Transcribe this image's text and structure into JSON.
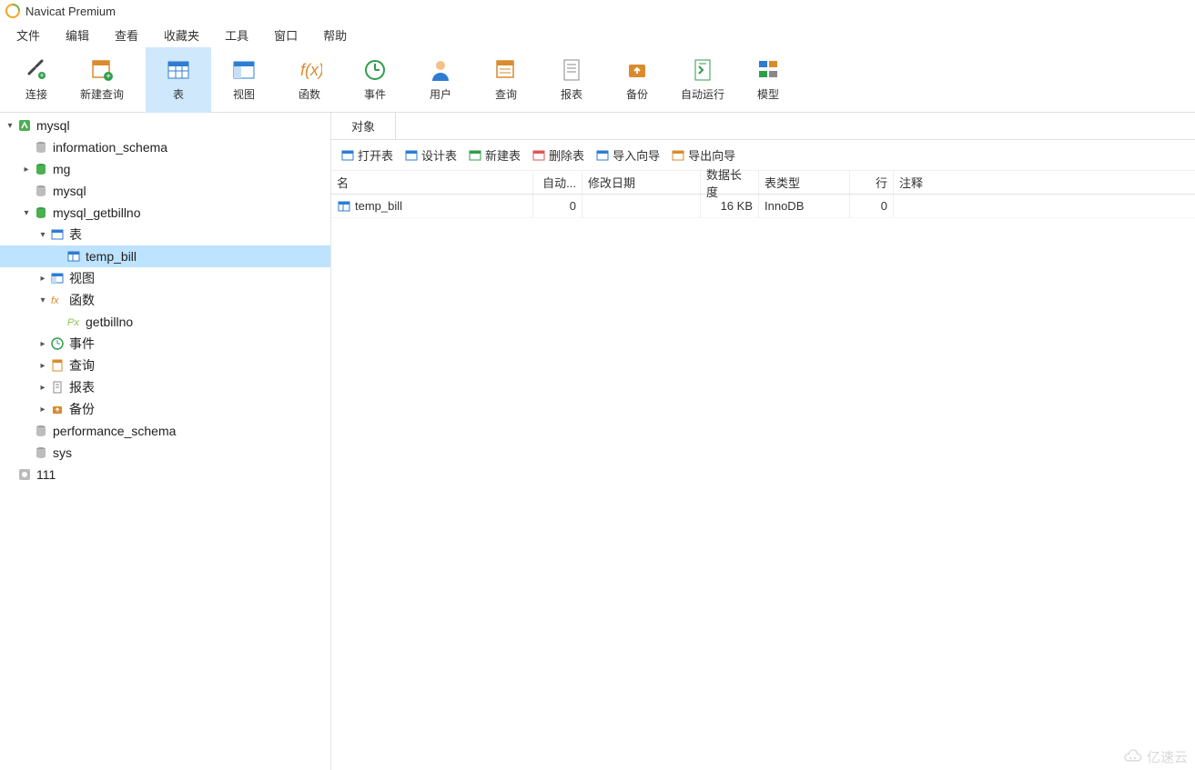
{
  "title": "Navicat Premium",
  "menubar": [
    "文件",
    "编辑",
    "查看",
    "收藏夹",
    "工具",
    "窗口",
    "帮助"
  ],
  "toolbar": [
    {
      "label": "连接",
      "icon": "plug",
      "active": false
    },
    {
      "label": "新建查询",
      "icon": "new-query",
      "active": false
    },
    {
      "label": "表",
      "icon": "table",
      "active": true
    },
    {
      "label": "视图",
      "icon": "view",
      "active": false
    },
    {
      "label": "函数",
      "icon": "function",
      "active": false
    },
    {
      "label": "事件",
      "icon": "event",
      "active": false
    },
    {
      "label": "用户",
      "icon": "user",
      "active": false
    },
    {
      "label": "查询",
      "icon": "query",
      "active": false
    },
    {
      "label": "报表",
      "icon": "report",
      "active": false
    },
    {
      "label": "备份",
      "icon": "backup",
      "active": false
    },
    {
      "label": "自动运行",
      "icon": "autorun",
      "active": false
    },
    {
      "label": "模型",
      "icon": "model",
      "active": false
    }
  ],
  "tree": {
    "root": [
      {
        "indent": 0,
        "chevron": "down",
        "icon": "conn-green",
        "label": "mysql"
      },
      {
        "indent": 1,
        "chevron": "",
        "icon": "db",
        "label": "information_schema"
      },
      {
        "indent": 1,
        "chevron": "right",
        "icon": "db-green",
        "label": "mg"
      },
      {
        "indent": 1,
        "chevron": "",
        "icon": "db",
        "label": "mysql"
      },
      {
        "indent": 1,
        "chevron": "down",
        "icon": "db-green",
        "label": "mysql_getbillno"
      },
      {
        "indent": 2,
        "chevron": "down",
        "icon": "tables",
        "label": "表"
      },
      {
        "indent": 3,
        "chevron": "",
        "icon": "table",
        "label": "temp_bill",
        "selected": true
      },
      {
        "indent": 2,
        "chevron": "right",
        "icon": "views",
        "label": "视图"
      },
      {
        "indent": 2,
        "chevron": "down",
        "icon": "fx",
        "label": "函数"
      },
      {
        "indent": 3,
        "chevron": "",
        "icon": "px",
        "label": "getbillno"
      },
      {
        "indent": 2,
        "chevron": "right",
        "icon": "event",
        "label": "事件"
      },
      {
        "indent": 2,
        "chevron": "right",
        "icon": "query-s",
        "label": "查询"
      },
      {
        "indent": 2,
        "chevron": "right",
        "icon": "report-s",
        "label": "报表"
      },
      {
        "indent": 2,
        "chevron": "right",
        "icon": "backup-s",
        "label": "备份"
      },
      {
        "indent": 1,
        "chevron": "",
        "icon": "db",
        "label": "performance_schema"
      },
      {
        "indent": 1,
        "chevron": "",
        "icon": "db",
        "label": "sys"
      },
      {
        "indent": 0,
        "chevron": "",
        "icon": "conn-grey",
        "label": "111"
      }
    ]
  },
  "tab_label": "对象",
  "obj_toolbar": [
    {
      "label": "打开表",
      "icon": "open-table"
    },
    {
      "label": "设计表",
      "icon": "design-table"
    },
    {
      "label": "新建表",
      "icon": "new-table"
    },
    {
      "label": "删除表",
      "icon": "delete-table"
    },
    {
      "label": "导入向导",
      "icon": "import-wiz"
    },
    {
      "label": "导出向导",
      "icon": "export-wiz"
    }
  ],
  "grid_headers": {
    "name": "名",
    "auto": "自动...",
    "mod": "修改日期",
    "size": "数据长度",
    "type": "表类型",
    "rows": "行",
    "comment": "注释"
  },
  "grid_rows": [
    {
      "name": "temp_bill",
      "auto": "0",
      "mod": "",
      "size": "16 KB",
      "type": "InnoDB",
      "rows": "0",
      "comment": ""
    }
  ],
  "watermark": "亿速云"
}
